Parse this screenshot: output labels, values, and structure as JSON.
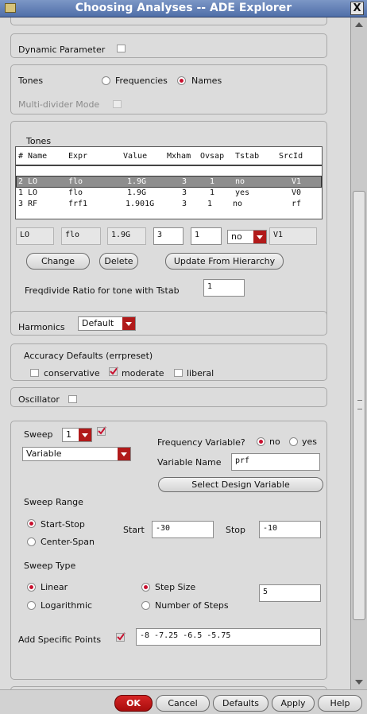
{
  "window": {
    "title": "Choosing Analyses -- ADE Explorer",
    "close_glyph": "X"
  },
  "dynamic_parameter": {
    "label": "Dynamic Parameter"
  },
  "tones_mode": {
    "label": "Tones",
    "options": [
      "Frequencies",
      "Names"
    ],
    "selected": "Names",
    "multidivider_label": "Multi-divider Mode"
  },
  "tones_table": {
    "group_label": "Tones",
    "headers": [
      "# Name",
      "Expr",
      "Value",
      "Mxham",
      "Ovsap",
      "Tstab",
      "SrcId"
    ],
    "rows": [
      {
        "num_name": "2 LO",
        "expr": "flo",
        "value": "1.9G",
        "mxham": "3",
        "ovsap": "1",
        "tstab": "no",
        "srcid": "V1"
      },
      {
        "num_name": "1 LO",
        "expr": "flo",
        "value": "1.9G",
        "mxham": "3",
        "ovsap": "1",
        "tstab": "yes",
        "srcid": "V0"
      },
      {
        "num_name": "3 RF",
        "expr": "frf1",
        "value": "1.901G",
        "mxham": "3",
        "ovsap": "1",
        "tstab": "no",
        "srcid": "rf"
      }
    ],
    "edit": {
      "name": "LO",
      "expr": "flo",
      "value": "1.9G",
      "mxham": "3",
      "ovsap": "1",
      "tstab": "no",
      "srcid": "V1"
    },
    "buttons": {
      "change": "Change",
      "delete": "Delete",
      "update": "Update From Hierarchy"
    },
    "freqdivide_label": "Freqdivide Ratio for tone with Tstab",
    "freqdivide_value": "1"
  },
  "harmonics": {
    "label": "Harmonics",
    "value": "Default"
  },
  "accuracy": {
    "label": "Accuracy Defaults (errpreset)",
    "options": [
      "conservative",
      "moderate",
      "liberal"
    ],
    "checked": "moderate"
  },
  "oscillator": {
    "label": "Oscillator"
  },
  "sweep": {
    "label": "Sweep",
    "count": "1",
    "type_value": "Variable",
    "freq_var_label": "Frequency Variable?",
    "freq_var_options": [
      "no",
      "yes"
    ],
    "freq_var_selected": "no",
    "var_name_label": "Variable Name",
    "var_name_value": "prf",
    "select_design_var": "Select Design Variable",
    "range_label": "Sweep Range",
    "range_options": [
      "Start-Stop",
      "Center-Span"
    ],
    "range_selected": "Start-Stop",
    "start_label": "Start",
    "start_value": "-30",
    "stop_label": "Stop",
    "stop_value": "-10",
    "sweep_type_label": "Sweep Type",
    "scale_options": [
      "Linear",
      "Logarithmic"
    ],
    "scale_selected": "Linear",
    "step_options": [
      "Step Size",
      "Number of Steps"
    ],
    "step_selected": "Step Size",
    "step_value": "5",
    "add_points_label": "Add Specific Points",
    "add_points_value": "-8 -7.25 -6.5 -5.75"
  },
  "footer": {
    "ok": "OK",
    "cancel": "Cancel",
    "defaults": "Defaults",
    "apply": "Apply",
    "help": "Help"
  },
  "colors": {
    "accent_red": "#c8102e",
    "title_blue": "#5a78b0"
  }
}
